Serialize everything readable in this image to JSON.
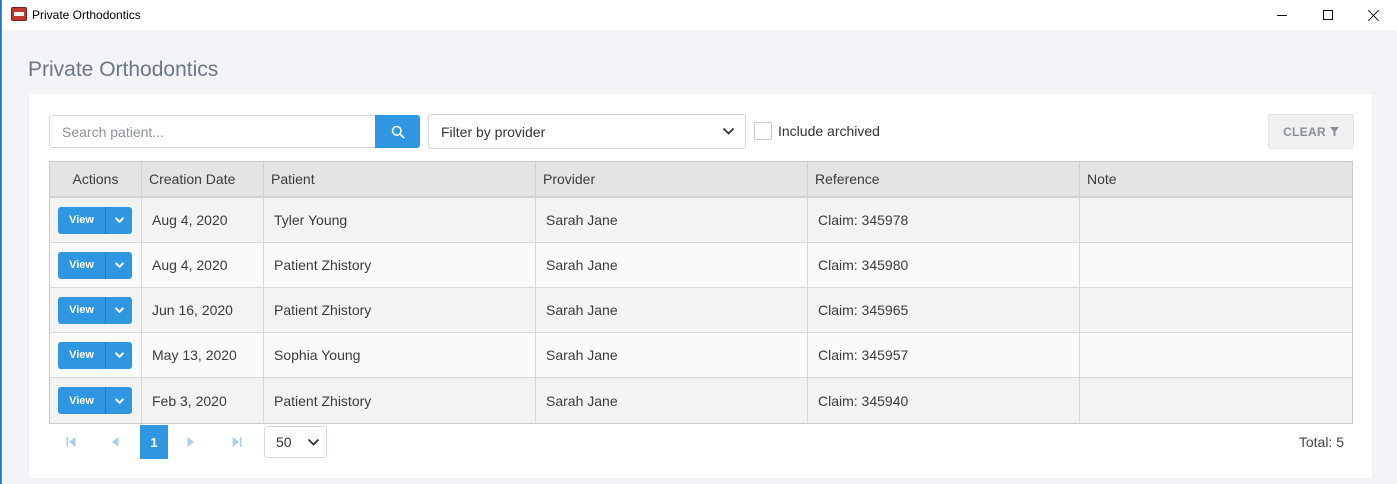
{
  "window": {
    "title": "Private Orthodontics"
  },
  "page": {
    "title": "Private Orthodontics"
  },
  "toolbar": {
    "search_placeholder": "Search patient...",
    "provider_filter": "Filter by provider",
    "include_archived": "Include archived",
    "clear_label": "CLEAR"
  },
  "table": {
    "columns": [
      "Actions",
      "Creation Date",
      "Patient",
      "Provider",
      "Reference",
      "Note"
    ],
    "view_label": "View",
    "rows": [
      {
        "date": "Aug 4, 2020",
        "patient": "Tyler Young",
        "provider": "Sarah Jane",
        "reference": "Claim: 345978",
        "note": ""
      },
      {
        "date": "Aug 4, 2020",
        "patient": "Patient Zhistory",
        "provider": "Sarah Jane",
        "reference": "Claim: 345980",
        "note": ""
      },
      {
        "date": "Jun 16, 2020",
        "patient": "Patient Zhistory",
        "provider": "Sarah Jane",
        "reference": "Claim: 345965",
        "note": ""
      },
      {
        "date": "May 13, 2020",
        "patient": "Sophia Young",
        "provider": "Sarah Jane",
        "reference": "Claim: 345957",
        "note": ""
      },
      {
        "date": "Feb 3, 2020",
        "patient": "Patient Zhistory",
        "provider": "Sarah Jane",
        "reference": "Claim: 345940",
        "note": ""
      }
    ]
  },
  "pager": {
    "current_page": "1",
    "page_size": "50",
    "total": "Total: 5"
  },
  "colors": {
    "accent": "#2f96e2",
    "header_bg": "#e4e4e4",
    "page_bg": "#f2f4f7"
  },
  "icons": {
    "search": "search-icon",
    "filter": "funnel-icon",
    "chevron": "chevron-down-icon"
  }
}
